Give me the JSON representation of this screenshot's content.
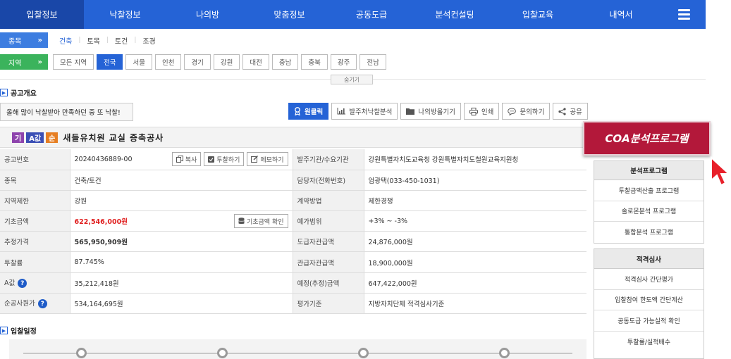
{
  "nav": {
    "items": [
      "입찰정보",
      "낙찰정보",
      "나의방",
      "맞춤정보",
      "공동도급",
      "분석컨설팅",
      "입찰교육",
      "내역서"
    ],
    "active_index": 0,
    "menu_icon": "hamburger-icon"
  },
  "filters": {
    "category_label": "종목",
    "categories": [
      "건축",
      "토목",
      "토건",
      "조경"
    ],
    "category_selected": "건축",
    "region_label": "지역",
    "regions": [
      "모든 지역",
      "전국",
      "서울",
      "인천",
      "경기",
      "강원",
      "대전",
      "충남",
      "충북",
      "광주",
      "전남"
    ],
    "region_selected": "전국",
    "hide_label": "숨기기"
  },
  "overview": {
    "section_title": "공고개요",
    "slogan": "올해 많이 낙찰받아 만족하던 중 또 낙찰!",
    "actions": [
      "원클릭",
      "발주처낙찰분석",
      "나의방옮기기",
      "인쇄",
      "문의하기",
      "공유"
    ],
    "badges": [
      "기",
      "A값",
      "순"
    ],
    "title": "새들유치원 교실 증축공사"
  },
  "info": {
    "rows": [
      {
        "l1": "공고번호",
        "v1": "20240436889-00",
        "l2": "발주기관/수요기관",
        "v2": "강원특별자치도교육청 강원특별자치도철원교육지원청"
      },
      {
        "l1": "종목",
        "v1": "건축/토건",
        "l2": "담당자(전화번호)",
        "v2": "엄광택(033-450-1031)"
      },
      {
        "l1": "지역제한",
        "v1": "강원",
        "l2": "계약방법",
        "v2": "제한경쟁"
      },
      {
        "l1": "기초금액",
        "v1": "622,546,000원",
        "l2": "예가범위",
        "v2": "+3% ~ -3%"
      },
      {
        "l1": "추정가격",
        "v1": "565,950,909원",
        "l2": "도급자관급액",
        "v2": "24,876,000원"
      },
      {
        "l1": "투찰률",
        "v1": "87.745%",
        "l2": "관급자관급액",
        "v2": "18,900,000원"
      },
      {
        "l1": "A값",
        "v1": "35,212,418원",
        "l2": "예정(추정)금액",
        "v2": "647,422,000원"
      },
      {
        "l1": "순공사원가",
        "v1": "534,164,695원",
        "l2": "평가기준",
        "v2": "지방자치단체 적격심사기준"
      }
    ],
    "row0_buttons": [
      "복사",
      "투찰하기",
      "메모하기"
    ],
    "row3_button": "기초금액 확인"
  },
  "schedule": {
    "section_title": "입찰일정"
  },
  "sidebar": {
    "coa_label": "COA분석프로그램",
    "analysis_title": "분석프로그램",
    "analysis_items": [
      "투찰금액산출 프로그램",
      "솔로몬분석 프로그램",
      "통합분석 프로그램"
    ],
    "review_title": "적격심사",
    "review_items": [
      "적격심사 간단평가",
      "입찰참여 한도액 간단계산",
      "공동도급 가능실적 확인",
      "투찰률/실적배수"
    ]
  },
  "colors": {
    "nav_blue": "#2563d6",
    "nav_active": "#1947a8",
    "coa_red": "#b3183a",
    "amount_red": "#e02020",
    "filter_green": "#3bb35c"
  }
}
